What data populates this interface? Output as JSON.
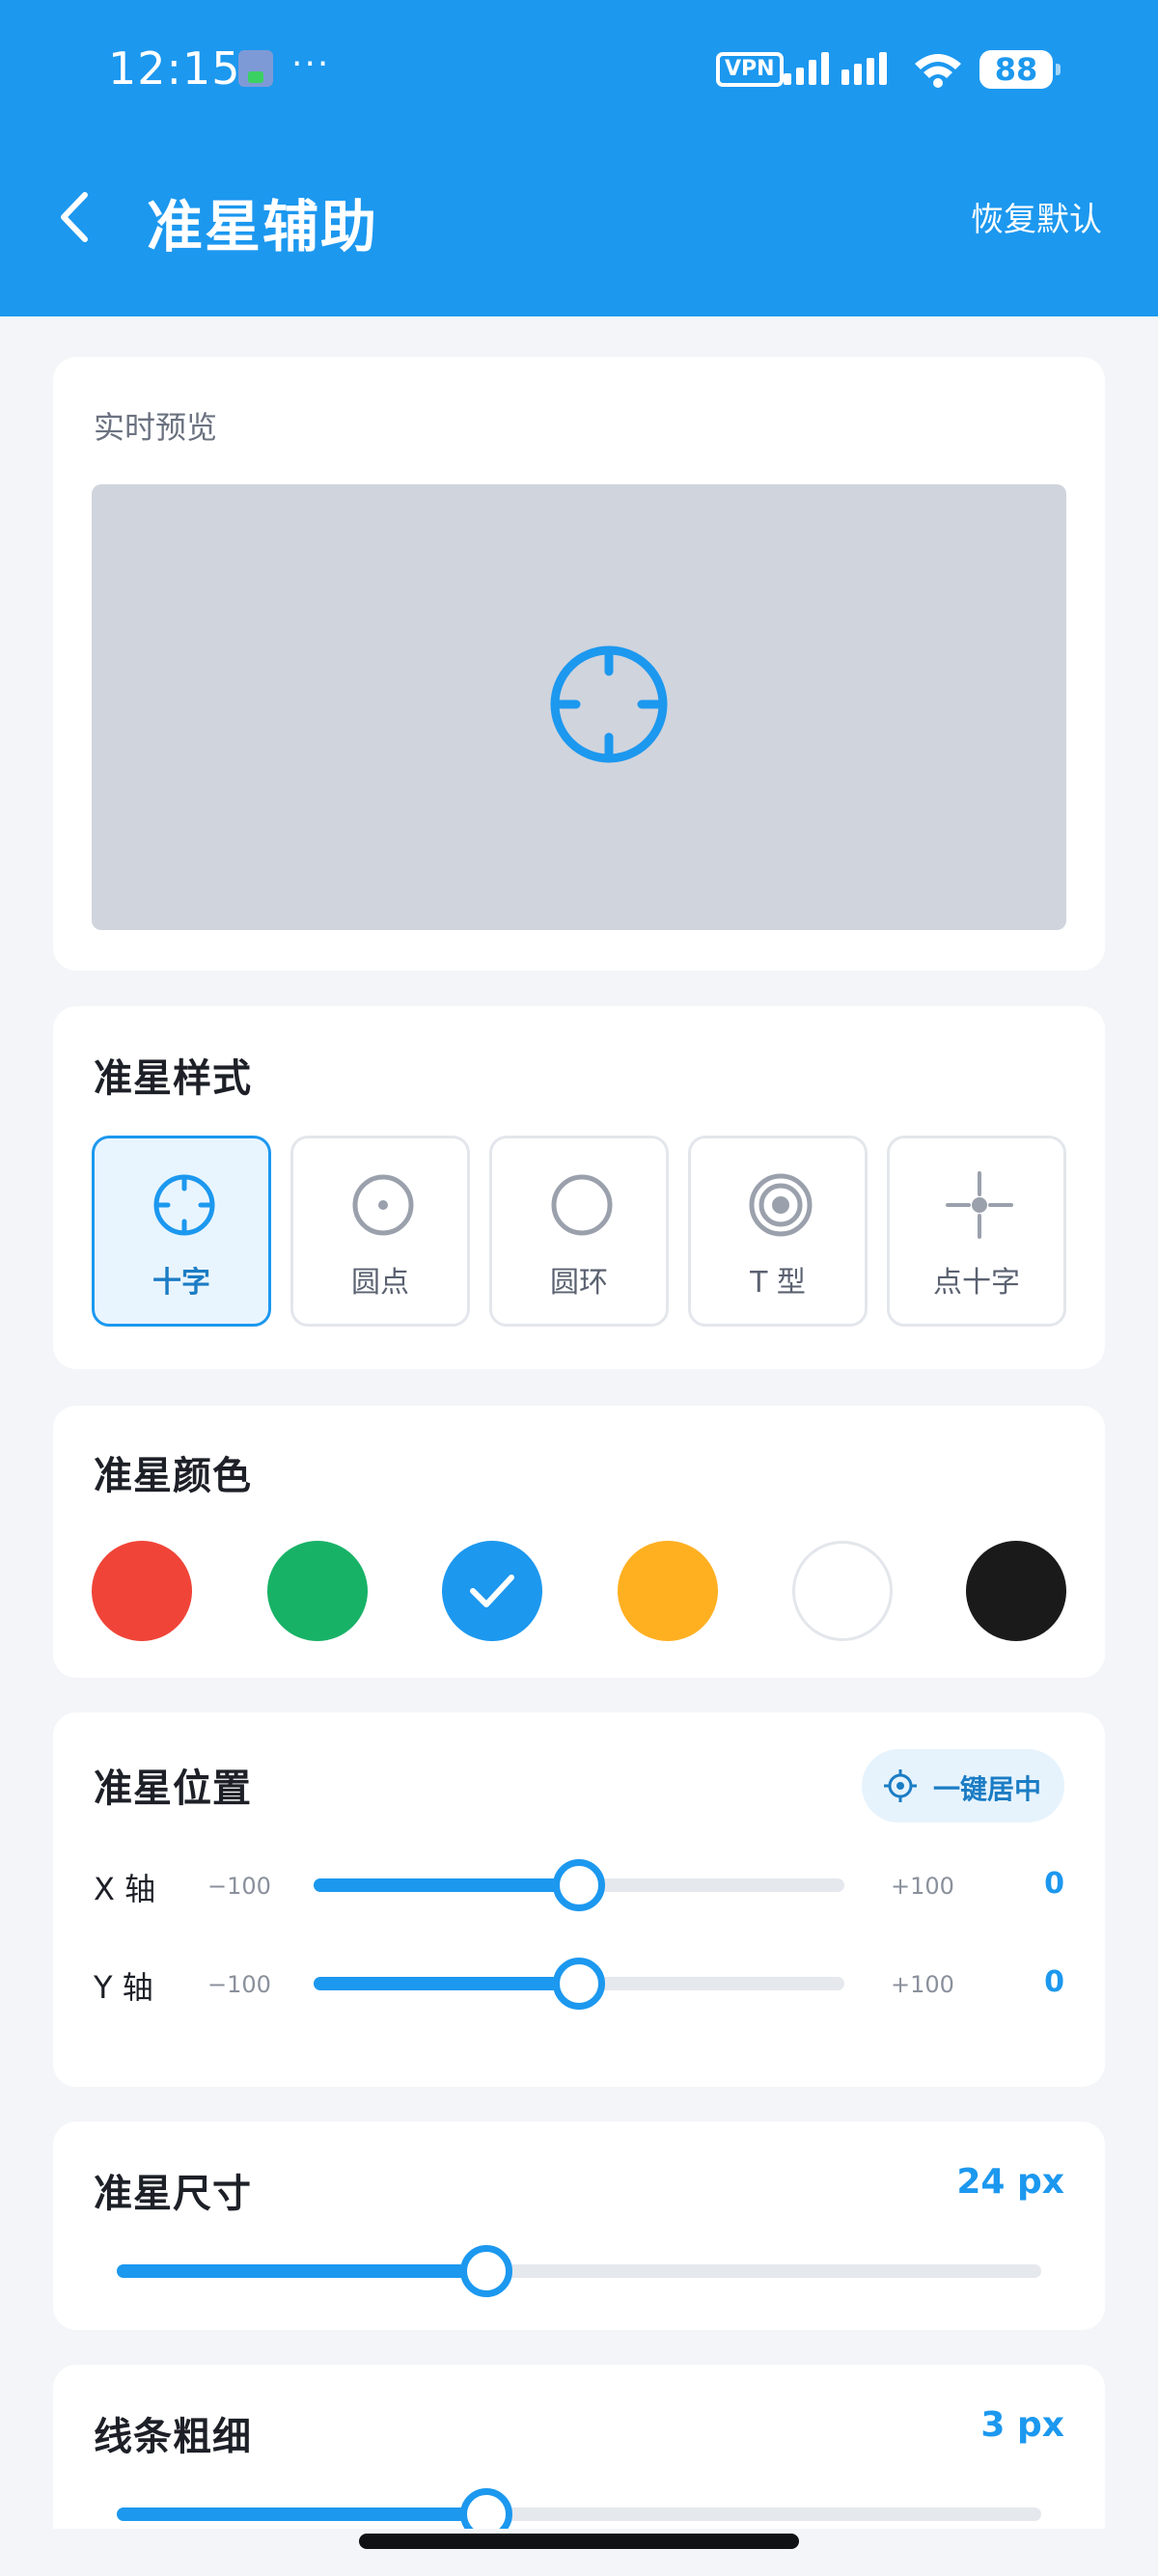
{
  "status_bar": {
    "time": "12:15",
    "dots": "···",
    "vpn": "VPN",
    "battery": "88"
  },
  "header": {
    "title": "准星辅助",
    "reset_label": "恢复默认"
  },
  "preview": {
    "label": "实时预览"
  },
  "style_section": {
    "title": "准星样式",
    "options": [
      {
        "label": "十字",
        "icon": "crosshair-icon",
        "selected": true
      },
      {
        "label": "圆点",
        "icon": "dot-icon",
        "selected": false
      },
      {
        "label": "圆环",
        "icon": "ring-icon",
        "selected": false
      },
      {
        "label": "T 型",
        "icon": "target-icon",
        "selected": false
      },
      {
        "label": "点十字",
        "icon": "dot-cross-icon",
        "selected": false
      }
    ]
  },
  "color_section": {
    "title": "准星颜色",
    "colors": [
      "#f04438",
      "#18b267",
      "#1c98ef",
      "#ffb021",
      "#ffffff",
      "#1a1a1a"
    ],
    "selected_index": 2
  },
  "position_section": {
    "title": "准星位置",
    "center_label": "一键居中",
    "x": {
      "label": "X 轴",
      "min": "−100",
      "max": "+100",
      "value": "0",
      "fraction": 0.5
    },
    "y": {
      "label": "Y 轴",
      "min": "−100",
      "max": "+100",
      "value": "0",
      "fraction": 0.5
    }
  },
  "size_section": {
    "title": "准星尺寸",
    "value": "24 px",
    "fraction": 0.4
  },
  "thickness_section": {
    "title": "线条粗细",
    "value": "3 px",
    "fraction": 0.4
  }
}
